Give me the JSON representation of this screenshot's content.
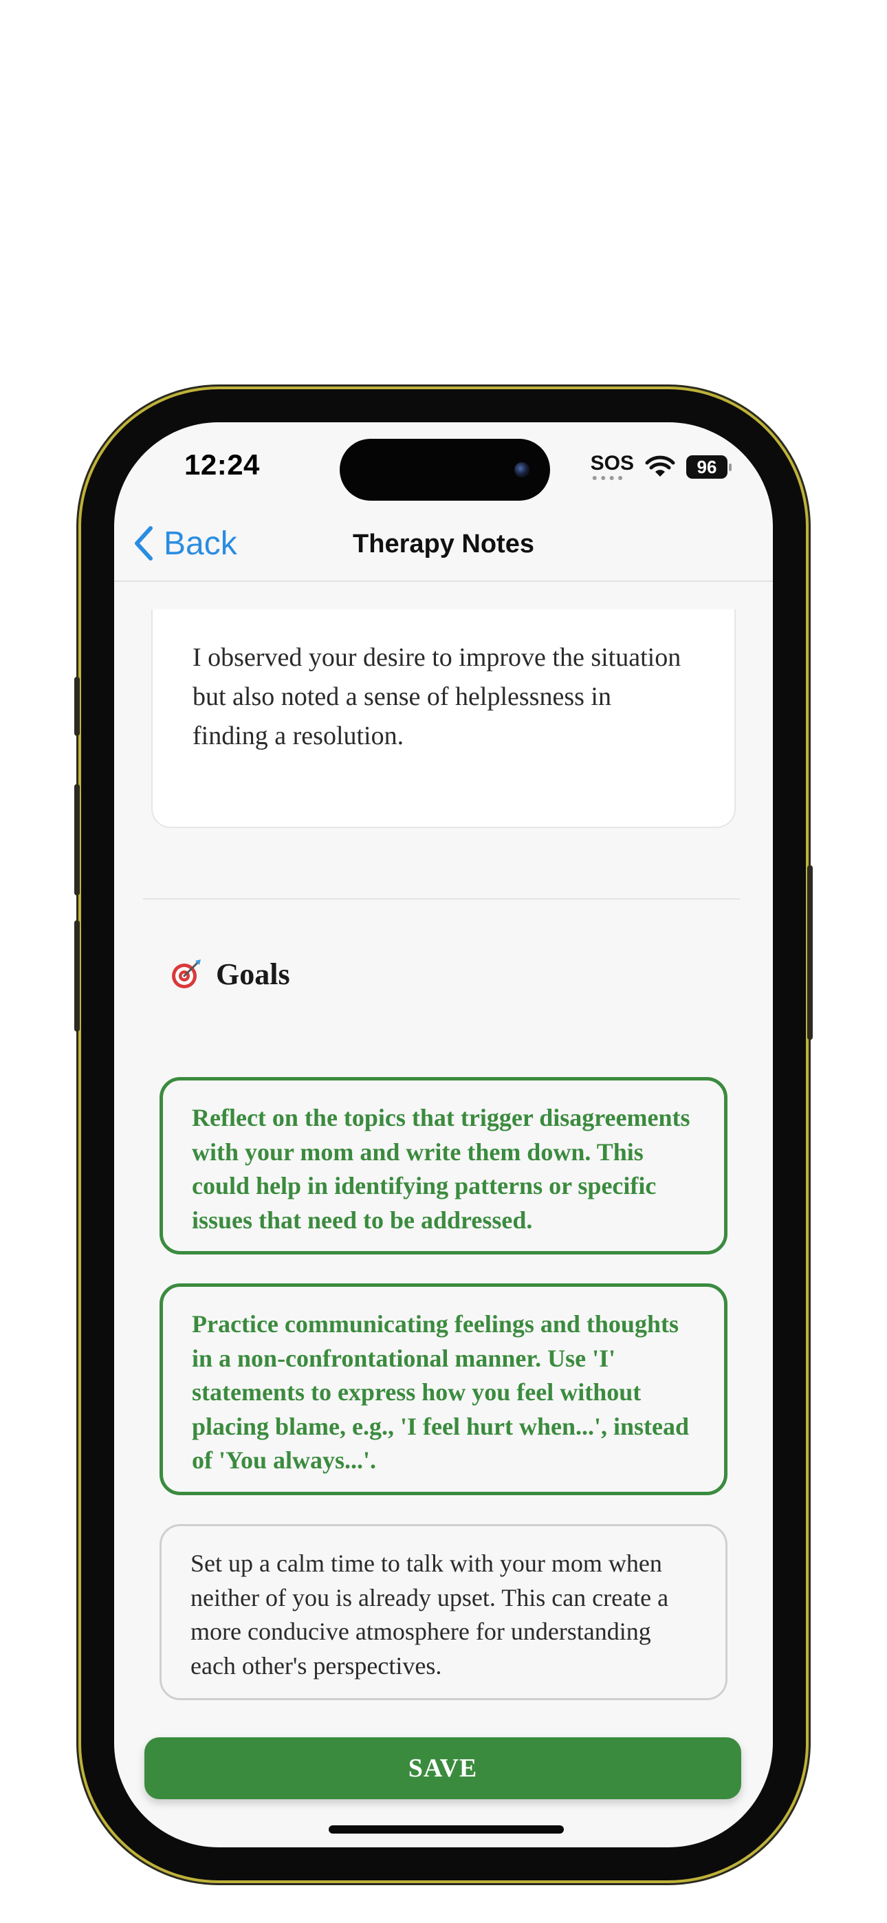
{
  "status_bar": {
    "time": "12:24",
    "sos_label": "SOS",
    "battery_level": "96"
  },
  "nav": {
    "back_label": "Back",
    "title": "Therapy Notes"
  },
  "observation": {
    "text": "I observed your desire to improve the situation but also noted a sense of helplessness in finding a resolution."
  },
  "goals": {
    "icon": "target-icon",
    "title": "Goals",
    "items": [
      {
        "text": "Reflect on the topics that trigger disagreements with your mom and write them down. This could help in identifying patterns or specific issues that need to be addressed.",
        "selected": true
      },
      {
        "text": "Practice communicating feelings and thoughts in a non-confrontational manner. Use 'I' statements to express how you feel without placing blame, e.g., 'I feel hurt when...', instead of 'You always...'.",
        "selected": true
      },
      {
        "text": "Set up a calm time to talk with your mom when neither of you is already upset. This can create a more conducive atmosphere for understanding each other's perspectives.",
        "selected": false
      }
    ]
  },
  "save_button": {
    "label": "SAVE"
  },
  "colors": {
    "accent_green": "#3b8b3e",
    "link_blue": "#2b8de0",
    "background": "#f7f7f7"
  }
}
